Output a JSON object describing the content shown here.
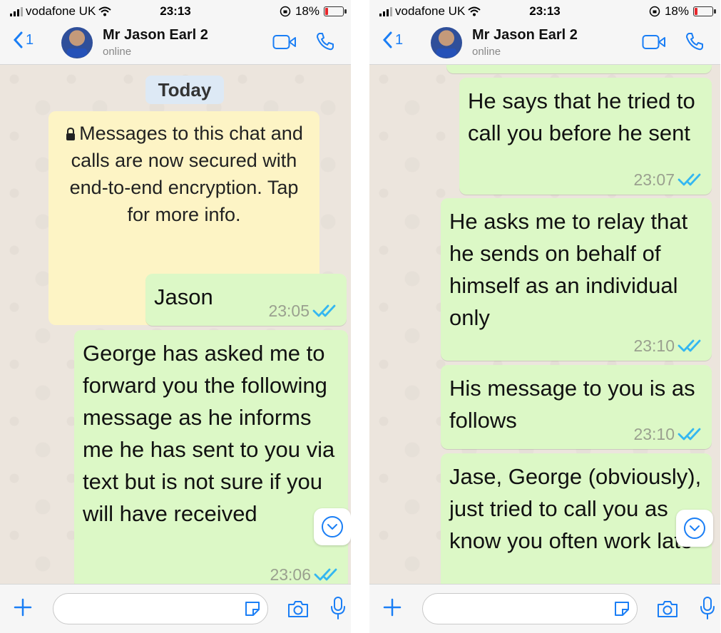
{
  "screens": [
    {
      "status_bar": {
        "carrier": "vodafone UK",
        "time": "23:13",
        "battery_percent": "18%",
        "battery_level": 0.18
      },
      "header": {
        "back_count": "1",
        "contact_name": "Mr Jason Earl 2",
        "presence": "online"
      },
      "chat": {
        "date_pill": "Today",
        "encryption_notice": "Messages to this chat and calls are now secured with end-to-end encryption. Tap for more info.",
        "messages": [
          {
            "text": "Jason",
            "time": "23:05"
          },
          {
            "text": "George has asked me to forward you the following message as he informs me he has sent to you via text but is not sure if you will have received",
            "time": "23:06"
          }
        ]
      }
    },
    {
      "status_bar": {
        "carrier": "vodafone UK",
        "time": "23:13",
        "battery_percent": "18%",
        "battery_level": 0.18
      },
      "header": {
        "back_count": "1",
        "contact_name": "Mr Jason Earl 2",
        "presence": "online"
      },
      "chat": {
        "messages": [
          {
            "text": "He says that he tried to call you before he sent",
            "time": "23:07"
          },
          {
            "text": "He asks me to relay that he sends on behalf of himself as an individual only",
            "time": "23:10"
          },
          {
            "text": "His message to you is as follows",
            "time": "23:10"
          },
          {
            "text": "Jase, George (obviously), just tried to call you as know you often work late",
            "time": ""
          }
        ]
      }
    }
  ],
  "icons": {
    "back": "chevron-left-icon",
    "video": "video-camera-icon",
    "call": "phone-icon",
    "read_receipt": "double-check-icon",
    "scroll": "chevron-down-icon",
    "attach": "plus-icon",
    "sticker": "sticker-icon",
    "camera": "camera-icon",
    "mic": "microphone-icon"
  },
  "colors": {
    "accent": "#1a7ef5",
    "bubble_out": "#dcf8c6",
    "chat_bg": "#ece5dd",
    "read_receipt": "#34b7f1",
    "encryption_bg": "#fdf4c5",
    "date_pill_bg": "#dde9f5",
    "battery_low": "#e8262c"
  }
}
